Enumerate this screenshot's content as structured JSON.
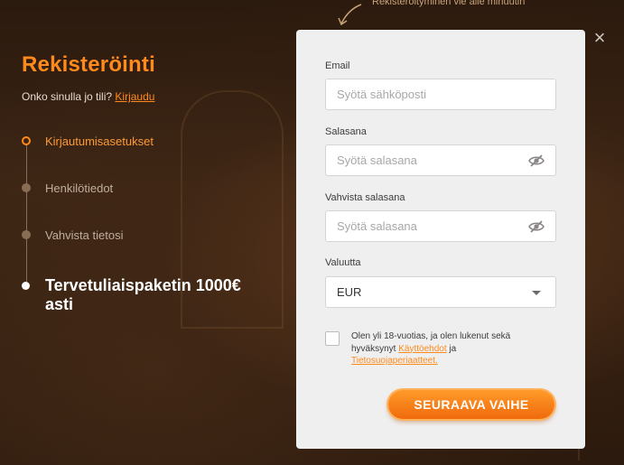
{
  "hint": {
    "text": "Rekisteröityminen vie alle minuutin"
  },
  "close": {
    "icon": "close-icon",
    "glyph": "×"
  },
  "left": {
    "title": "Rekisteröinti",
    "login_prompt": "Onko sinulla jo tili?",
    "login_link": "Kirjaudu",
    "steps": [
      {
        "label": "Kirjautumisasetukset",
        "state": "active"
      },
      {
        "label": "Henkilötiedot",
        "state": "pending"
      },
      {
        "label": "Vahvista tietosi",
        "state": "pending"
      },
      {
        "label": "Tervetuliaispaketin 1000€ asti",
        "state": "bonus"
      }
    ]
  },
  "form": {
    "email": {
      "label": "Email",
      "placeholder": "Syötä sähköposti",
      "value": ""
    },
    "password": {
      "label": "Salasana",
      "placeholder": "Syötä salasana",
      "value": "",
      "icon": "eye-off-icon"
    },
    "confirm_password": {
      "label": "Vahvista salasana",
      "placeholder": "Syötä salasana",
      "value": "",
      "icon": "eye-off-icon"
    },
    "currency": {
      "label": "Valuutta",
      "value": "EUR",
      "icon": "chevron-down-icon"
    },
    "terms": {
      "checked": false,
      "text_before": "Olen yli 18-vuotias, ja olen lukenut sekä hyväksynyt",
      "link1": "Käyttöehdot",
      "text_middle": "ja",
      "link2": "Tietosuojaperiaatteet."
    },
    "submit_label": "SEURAAVA VAIHE"
  },
  "colors": {
    "accent": "#ff8a1c",
    "panel": "#f0efef",
    "background": "#2a1a10"
  }
}
